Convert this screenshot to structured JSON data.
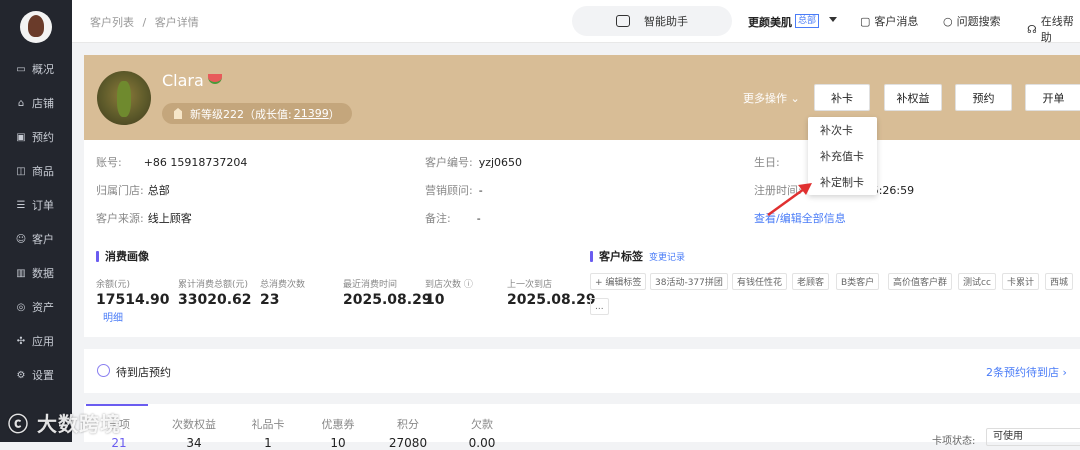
{
  "sidebar": {
    "items": [
      {
        "label": "概况",
        "icon": "monitor-icon"
      },
      {
        "label": "店铺",
        "icon": "store-icon"
      },
      {
        "label": "预约",
        "icon": "calendar-icon"
      },
      {
        "label": "商品",
        "icon": "product-icon"
      },
      {
        "label": "订单",
        "icon": "order-icon"
      },
      {
        "label": "客户",
        "icon": "user-icon"
      },
      {
        "label": "数据",
        "icon": "chart-icon"
      },
      {
        "label": "资产",
        "icon": "asset-icon"
      },
      {
        "label": "应用",
        "icon": "apps-icon"
      },
      {
        "label": "设置",
        "icon": "gear-icon"
      }
    ]
  },
  "breadcrumb": {
    "list": "客户列表",
    "sep": "/",
    "detail": "客户详情"
  },
  "topbar": {
    "assistant": "智能助手",
    "brand": "更颜美肌",
    "brand_tag": "总部",
    "messages": "客户消息",
    "help": "问题搜索",
    "online": "在线帮助"
  },
  "customer": {
    "name": "Clara",
    "level_text": "新等级222（成长值:",
    "growth": "21399",
    "level_close": "）"
  },
  "actions": {
    "more": "更多操作",
    "buttons": [
      "补卡",
      "补权益",
      "预约",
      "开单"
    ]
  },
  "dropdown": {
    "items": [
      "补次卡",
      "补充值卡",
      "补定制卡"
    ]
  },
  "info": {
    "account_label": "账号:",
    "account": "+86 15918737204",
    "customer_no_label": "客户编号:",
    "customer_no": "yzj0650",
    "birthday_label": "生日:",
    "store_label": "归属门店:",
    "store": "总部",
    "consultant_label": "营销顾问:",
    "consultant": "-",
    "register_label": "注册时间:",
    "register_time": "5:26:59",
    "source_label": "客户来源:",
    "source": "线上顾客",
    "remark_label": "备注:",
    "remark": "-",
    "view_all": "查看/编辑全部信息"
  },
  "consumption": {
    "title": "消费画像",
    "stats": [
      {
        "label": "余额(元)",
        "value": "17514.90",
        "extra": "明细"
      },
      {
        "label": "累计消费总额(元)",
        "value": "33020.62"
      },
      {
        "label": "总消费次数",
        "value": "23"
      },
      {
        "label": "最近消费时间",
        "value": "2025.08.29"
      },
      {
        "label": "到店次数",
        "value": "10"
      },
      {
        "label": "上一次到店",
        "value": "2025.08.29"
      }
    ]
  },
  "tags": {
    "title": "客户标签",
    "change_log": "变更记录",
    "add": "+ 编辑标签",
    "items": [
      "38活动-377拼团",
      "有钱任性花",
      "老顾客",
      "B类客户",
      "高价值客户群",
      "测试cc",
      "卡累计",
      "西城"
    ],
    "more": "..."
  },
  "appointment": {
    "title": "待到店预约",
    "link": "2条预约待到店"
  },
  "tabs": [
    {
      "label": "卡项",
      "count": "21"
    },
    {
      "label": "次数权益",
      "count": "34"
    },
    {
      "label": "礼品卡",
      "count": "1"
    },
    {
      "label": "优惠券",
      "count": "10"
    },
    {
      "label": "积分",
      "count": "27080"
    },
    {
      "label": "欠款",
      "count": "0.00"
    }
  ],
  "card_status": {
    "label": "卡项状态:",
    "value": "可使用"
  },
  "watermark": "大数跨境",
  "colors": {
    "profile_bg": "#d8bd96",
    "sidebar_bg": "#23262e",
    "accent": "#4a7cf7",
    "arrow": "#e03030"
  }
}
